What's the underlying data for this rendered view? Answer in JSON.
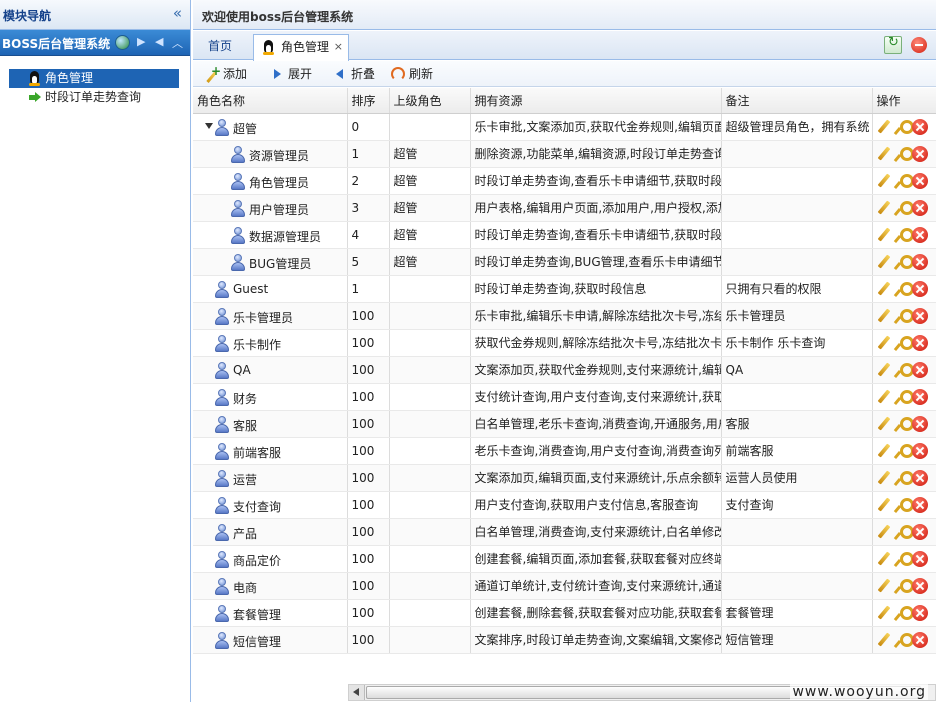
{
  "nav": {
    "title": "模块导航",
    "collapse_icon": "double-chevron-left-icon",
    "system_name": "BOSS后台管理系统",
    "tree": [
      {
        "label": "角色管理",
        "icon": "penguin-icon",
        "selected": true
      },
      {
        "label": "时段订单走势查询",
        "icon": "green-arrow-icon",
        "selected": false
      }
    ]
  },
  "header": {
    "welcome": "欢迎使用boss后台管理系统"
  },
  "tabs": {
    "home_label": "首页",
    "active_label": "角色管理",
    "close_glyph": "×"
  },
  "toolbar": {
    "add_label": "添加",
    "expand_label": "展开",
    "collapse_label": "折叠",
    "refresh_label": "刷新"
  },
  "grid": {
    "columns": [
      "角色名称",
      "排序",
      "上级角色",
      "拥有资源",
      "备注",
      "操作"
    ],
    "rows": [
      {
        "name": "超管",
        "level": 0,
        "expandable": true,
        "sort": "0",
        "parent": "",
        "resources": "乐卡审批,文案添加页,获取代金券规则,编辑页面,",
        "remark": "超级管理员角色，拥有系统"
      },
      {
        "name": "资源管理员",
        "level": 1,
        "expandable": false,
        "sort": "1",
        "parent": "超管",
        "resources": "删除资源,功能菜单,编辑资源,时段订单走势查询",
        "remark": ""
      },
      {
        "name": "角色管理员",
        "level": 1,
        "expandable": false,
        "sort": "2",
        "parent": "超管",
        "resources": "时段订单走势查询,查看乐卡申请细节,获取时段",
        "remark": ""
      },
      {
        "name": "用户管理员",
        "level": 1,
        "expandable": false,
        "sort": "3",
        "parent": "超管",
        "resources": "用户表格,编辑用户页面,添加用户,用户授权,添加",
        "remark": ""
      },
      {
        "name": "数据源管理员",
        "level": 1,
        "expandable": false,
        "sort": "4",
        "parent": "超管",
        "resources": "时段订单走势查询,查看乐卡申请细节,获取时段",
        "remark": ""
      },
      {
        "name": "BUG管理员",
        "level": 1,
        "expandable": false,
        "sort": "5",
        "parent": "超管",
        "resources": "时段订单走势查询,BUG管理,查看乐卡申请细节",
        "remark": ""
      },
      {
        "name": "Guest",
        "level": 0,
        "expandable": false,
        "sort": "1",
        "parent": "",
        "resources": "时段订单走势查询,获取时段信息",
        "remark": "只拥有只看的权限"
      },
      {
        "name": "乐卡管理员",
        "level": 0,
        "expandable": false,
        "sort": "100",
        "parent": "",
        "resources": "乐卡审批,编辑乐卡申请,解除冻结批次卡号,冻结",
        "remark": "乐卡管理员"
      },
      {
        "name": "乐卡制作",
        "level": 0,
        "expandable": false,
        "sort": "100",
        "parent": "",
        "resources": "获取代金券规则,解除冻结批次卡号,冻结批次卡号",
        "remark": "乐卡制作  乐卡查询"
      },
      {
        "name": "QA",
        "level": 0,
        "expandable": false,
        "sort": "100",
        "parent": "",
        "resources": "文案添加页,获取代金券规则,支付来源统计,编辑",
        "remark": "QA"
      },
      {
        "name": "财务",
        "level": 0,
        "expandable": false,
        "sort": "100",
        "parent": "",
        "resources": "支付统计查询,用户支付查询,支付来源统计,获取",
        "remark": ""
      },
      {
        "name": "客服",
        "level": 0,
        "expandable": false,
        "sort": "100",
        "parent": "",
        "resources": "白名单管理,老乐卡查询,消费查询,开通服务,用户",
        "remark": "客服"
      },
      {
        "name": "前端客服",
        "level": 0,
        "expandable": false,
        "sort": "100",
        "parent": "",
        "resources": "老乐卡查询,消费查询,用户支付查询,消费查询列",
        "remark": "前端客服"
      },
      {
        "name": "运营",
        "level": 0,
        "expandable": false,
        "sort": "100",
        "parent": "",
        "resources": "文案添加页,编辑页面,支付来源统计,乐点余额转",
        "remark": "运营人员使用"
      },
      {
        "name": "支付查询",
        "level": 0,
        "expandable": false,
        "sort": "100",
        "parent": "",
        "resources": "用户支付查询,获取用户支付信息,客服查询",
        "remark": "支付查询"
      },
      {
        "name": "产品",
        "level": 0,
        "expandable": false,
        "sort": "100",
        "parent": "",
        "resources": "白名单管理,消费查询,支付来源统计,白名单修改",
        "remark": ""
      },
      {
        "name": "商品定价",
        "level": 0,
        "expandable": false,
        "sort": "100",
        "parent": "",
        "resources": "创建套餐,编辑页面,添加套餐,获取套餐对应终端",
        "remark": ""
      },
      {
        "name": "电商",
        "level": 0,
        "expandable": false,
        "sort": "100",
        "parent": "",
        "resources": "通道订单统计,支付统计查询,支付来源统计,通道",
        "remark": ""
      },
      {
        "name": "套餐管理",
        "level": 0,
        "expandable": false,
        "sort": "100",
        "parent": "",
        "resources": "创建套餐,删除套餐,获取套餐对应功能,获取套餐",
        "remark": "套餐管理"
      },
      {
        "name": "短信管理",
        "level": 0,
        "expandable": false,
        "sort": "100",
        "parent": "",
        "resources": "文案排序,时段订单走势查询,文案编辑,文案修改",
        "remark": "短信管理"
      }
    ]
  },
  "watermark": "www.wooyun.org"
}
